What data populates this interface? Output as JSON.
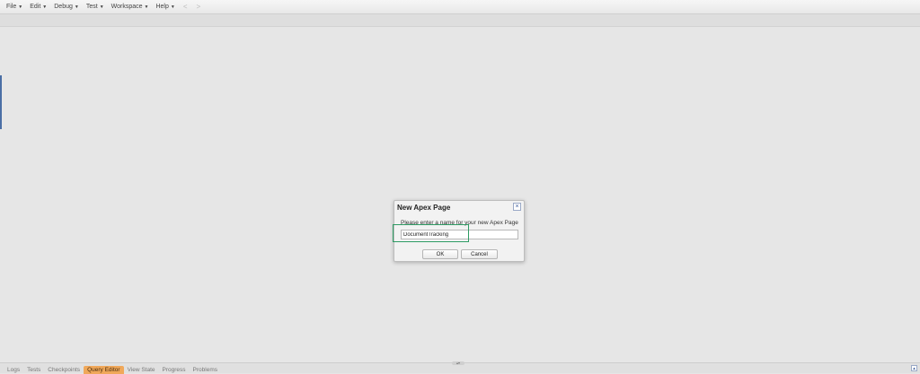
{
  "menubar": {
    "items": [
      {
        "label": "File"
      },
      {
        "label": "Edit"
      },
      {
        "label": "Debug"
      },
      {
        "label": "Test"
      },
      {
        "label": "Workspace"
      },
      {
        "label": "Help"
      }
    ],
    "back_glyph": "<",
    "forward_glyph": ">"
  },
  "dialog": {
    "title": "New Apex Page",
    "close_glyph": "×",
    "prompt": "Please enter a name for your new Apex Page",
    "input_value": "DocumentTracking",
    "ok_label": "OK",
    "cancel_label": "Cancel"
  },
  "bottom_panel": {
    "tabs": [
      {
        "label": "Logs"
      },
      {
        "label": "Tests"
      },
      {
        "label": "Checkpoints"
      },
      {
        "label": "Query Editor",
        "active": true
      },
      {
        "label": "View State"
      },
      {
        "label": "Progress"
      },
      {
        "label": "Problems"
      }
    ],
    "splitter_glyph": "▴▾"
  },
  "colors": {
    "highlight": "#2e9b64",
    "active_tab": "#f0a85a"
  },
  "icons": {
    "menu_caret": "caret-down-icon",
    "dialog_close": "close-icon",
    "panel_toggle": "panel-toggle-icon"
  }
}
